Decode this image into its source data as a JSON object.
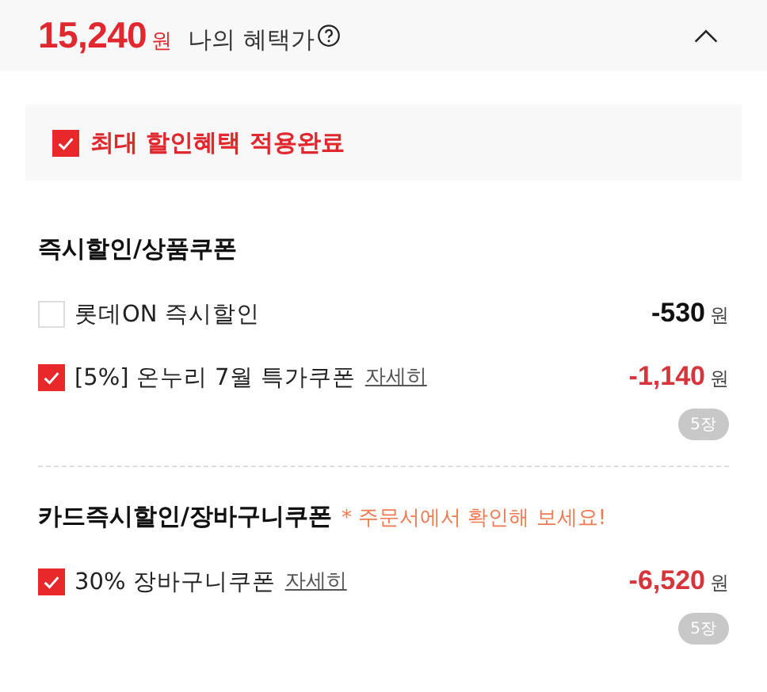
{
  "summary": {
    "price": "15,240",
    "unit": "원",
    "label": "나의 혜택가",
    "expanded": true
  },
  "max_discount": {
    "label": "최대 할인혜택 적용완료",
    "checked": true
  },
  "sections": [
    {
      "title": "즉시할인/상품쿠폰",
      "items": [
        {
          "label": "롯데ON 즉시할인",
          "checked": false,
          "amount": "-530",
          "unit": "원"
        },
        {
          "label": "[5%] 온누리 7월 특가쿠폰",
          "link": "자세히",
          "checked": true,
          "amount": "-1,140",
          "unit": "원",
          "count": "5장"
        }
      ]
    },
    {
      "title": "카드즉시할인/장바구니쿠폰",
      "note": "* 주문서에서 확인해 보세요!",
      "items": [
        {
          "label": "30% 장바구니쿠폰",
          "link": "자세히",
          "checked": true,
          "amount": "-6,520",
          "unit": "원",
          "count": "5장"
        }
      ]
    }
  ]
}
